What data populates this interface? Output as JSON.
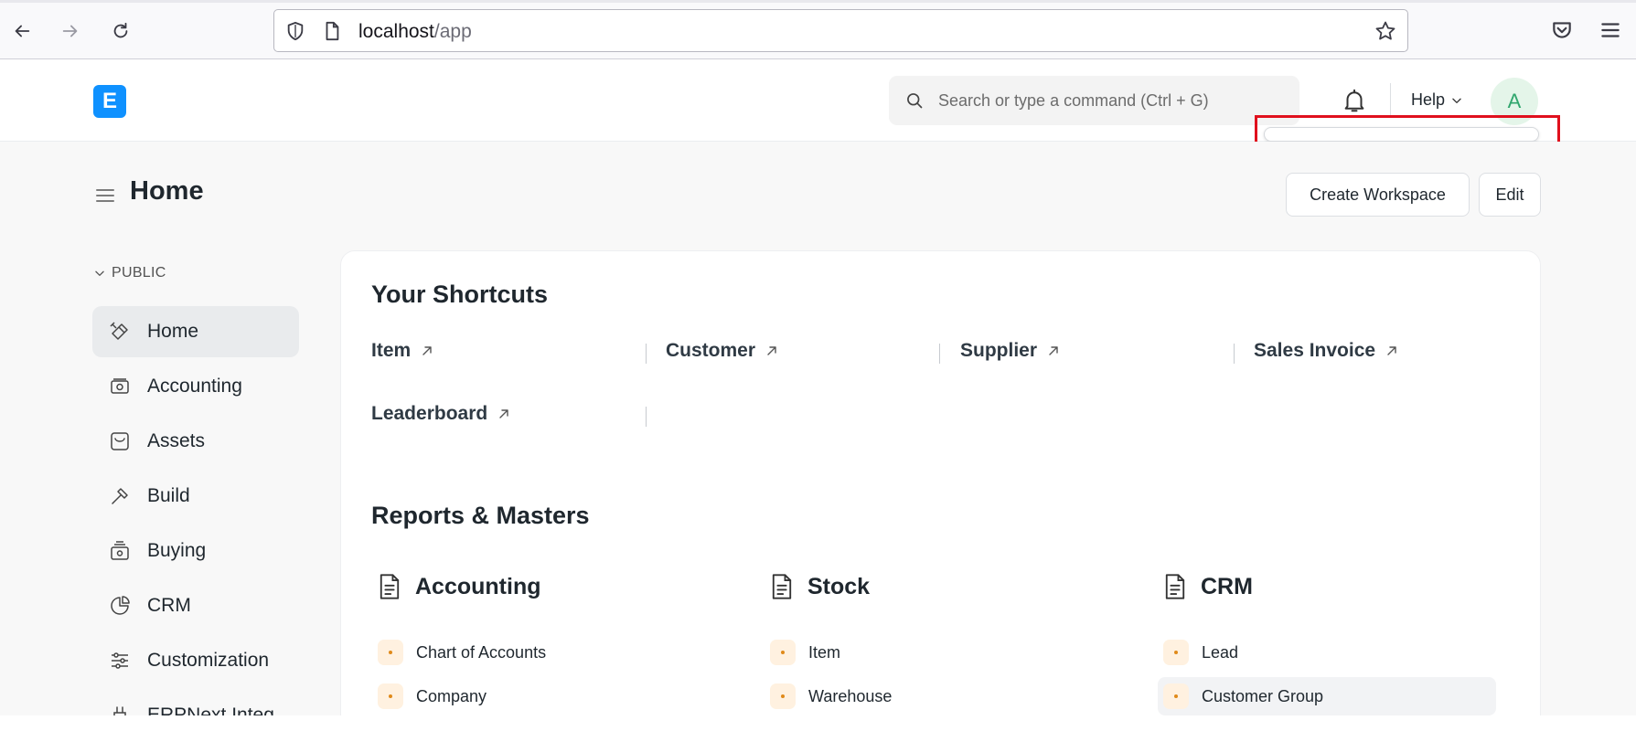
{
  "browser": {
    "url_host": "localhost",
    "url_path": "/app"
  },
  "navbar": {
    "logo_letter": "E",
    "search_placeholder": "Search or type a command (Ctrl + G)",
    "help_label": "Help",
    "avatar_initial": "A"
  },
  "page": {
    "title": "Home",
    "create_workspace_label": "Create Workspace",
    "edit_label": "Edit"
  },
  "sidebar": {
    "section_label": "PUBLIC",
    "items": [
      {
        "label": "Home",
        "icon": "tools-icon",
        "active": true
      },
      {
        "label": "Accounting",
        "icon": "accounting-icon"
      },
      {
        "label": "Assets",
        "icon": "assets-icon"
      },
      {
        "label": "Build",
        "icon": "build-icon"
      },
      {
        "label": "Buying",
        "icon": "buying-icon"
      },
      {
        "label": "CRM",
        "icon": "crm-icon"
      },
      {
        "label": "Customization",
        "icon": "customization-icon"
      },
      {
        "label": "ERPNext Integ...",
        "icon": "integration-icon"
      }
    ]
  },
  "shortcuts": {
    "title": "Your Shortcuts",
    "items": [
      "Item",
      "Customer",
      "Supplier",
      "Sales Invoice",
      "Leaderboard"
    ]
  },
  "reports": {
    "title": "Reports & Masters",
    "groups": [
      {
        "title": "Accounting",
        "links": [
          "Chart of Accounts",
          "Company"
        ]
      },
      {
        "title": "Stock",
        "links": [
          "Item",
          "Warehouse"
        ]
      },
      {
        "title": "CRM",
        "links": [
          "Lead",
          "Customer Group"
        ]
      }
    ]
  },
  "colors": {
    "brand": "#0f91ff",
    "highlight": "#e0101d",
    "avatar_bg": "#e4f5e9",
    "avatar_fg": "#30a66d"
  }
}
